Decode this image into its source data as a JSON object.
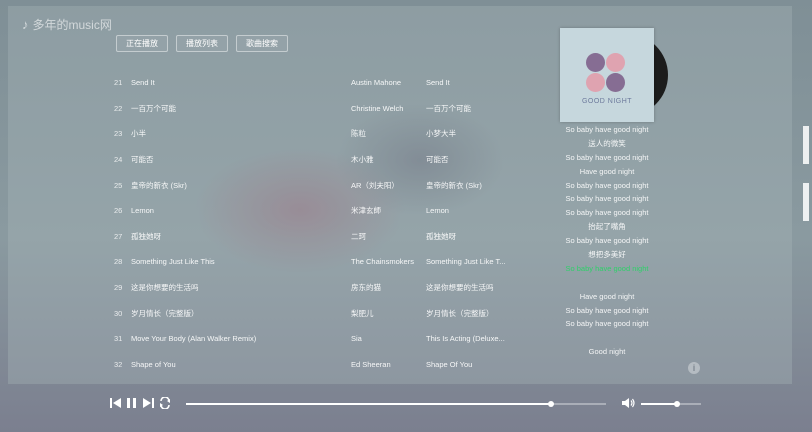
{
  "app": {
    "logo_text": "多年的music网"
  },
  "tabs": [
    {
      "label": "正在播放"
    },
    {
      "label": "播放列表"
    },
    {
      "label": "歌曲搜索"
    }
  ],
  "songs": [
    {
      "num": "21",
      "name": "Send It",
      "singer": "Austin Mahone",
      "album": "Send It"
    },
    {
      "num": "22",
      "name": "一百万个可能",
      "singer": "Christine Welch",
      "album": "一百万个可能"
    },
    {
      "num": "23",
      "name": "小半",
      "singer": "陈粒",
      "album": "小梦大半"
    },
    {
      "num": "24",
      "name": "可能否",
      "singer": "木小雅",
      "album": "可能否"
    },
    {
      "num": "25",
      "name": "皇帝的新衣 (Skr)",
      "singer": "AR（刘夫阳）",
      "album": "皇帝的新衣 (Skr)"
    },
    {
      "num": "26",
      "name": "Lemon",
      "singer": "米津玄師",
      "album": "Lemon"
    },
    {
      "num": "27",
      "name": "孤独她呀",
      "singer": "二珂",
      "album": "孤独她呀"
    },
    {
      "num": "28",
      "name": "Something Just Like This",
      "singer": "The Chainsmokers",
      "album": "Something Just Like T..."
    },
    {
      "num": "29",
      "name": "这是你想要的生活吗",
      "singer": "房东的猫",
      "album": "这是你想要的生活吗"
    },
    {
      "num": "30",
      "name": "岁月情长（完整版）",
      "singer": "梨肥儿",
      "album": "岁月情长（完整版）"
    },
    {
      "num": "31",
      "name": "Move Your Body (Alan Walker Remix)",
      "singer": "Sia",
      "album": "This Is Acting (Deluxe..."
    },
    {
      "num": "32",
      "name": "Shape of You",
      "singer": "Ed Sheeran",
      "album": "Shape Of You"
    }
  ],
  "now_playing": {
    "cover_title": "GOOD NIGHT",
    "cover_colors": [
      "#7a5a86",
      "#e39aa8",
      "#e39aa8",
      "#7a5a86"
    ],
    "lyrics": [
      "So baby have good night",
      "送人的微笑",
      "So baby have good night",
      "Have good night",
      "So baby have good night",
      "So baby have good night",
      "So baby have good night",
      "抬起了嘴角",
      "So baby have good night",
      "想把多美好",
      "So baby have good night",
      "",
      "Have good night",
      "So baby have good night",
      "So baby have good night",
      "",
      "Good night"
    ],
    "active_lyric_index": 10
  },
  "player": {
    "progress": 0.87,
    "volume": 0.6,
    "accent_color": "#2fd06a"
  }
}
